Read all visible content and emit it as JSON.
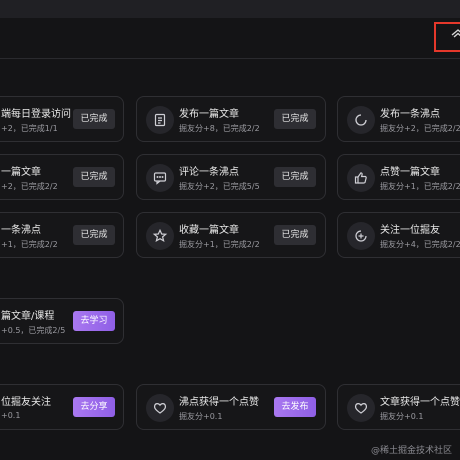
{
  "accent_color": "#9b6bf0",
  "header": {
    "settings_icon": "gear-icon"
  },
  "rows": [
    {
      "cards": [
        {
          "icon": "user-icon",
          "title": "端每日登录访问",
          "sub": "+2，已完成1/1",
          "btn": "已完成",
          "btn_type": "done"
        },
        {
          "icon": "document-icon",
          "title": "发布一篇文章",
          "sub": "掘友分+8，已完成2/2",
          "btn": "已完成",
          "btn_type": "done"
        },
        {
          "icon": "spinner-icon",
          "title": "发布一条沸点",
          "sub": "掘友分+2，已完成2/2",
          "btn": "",
          "btn_type": "none"
        }
      ]
    },
    {
      "cards": [
        {
          "icon": "document-icon",
          "title": "一篇文章",
          "sub": "+2，已完成2/2",
          "btn": "已完成",
          "btn_type": "done"
        },
        {
          "icon": "comment-icon",
          "title": "评论一条沸点",
          "sub": "掘友分+2，已完成5/5",
          "btn": "已完成",
          "btn_type": "done"
        },
        {
          "icon": "thumbs-up-icon",
          "title": "点赞一篇文章",
          "sub": "掘友分+1，已完成2/2",
          "btn": "",
          "btn_type": "none"
        }
      ]
    },
    {
      "cards": [
        {
          "icon": "star-icon",
          "title": "一条沸点",
          "sub": "+1，已完成2/2",
          "btn": "已完成",
          "btn_type": "done"
        },
        {
          "icon": "star-icon",
          "title": "收藏一篇文章",
          "sub": "掘友分+1，已完成2/2",
          "btn": "已完成",
          "btn_type": "done"
        },
        {
          "icon": "follow-icon",
          "title": "关注一位掘友",
          "sub": "掘友分+4，已完成2/2",
          "btn": "",
          "btn_type": "none"
        }
      ]
    },
    {
      "cards": [
        {
          "icon": "book-icon",
          "title": "篇文章/课程",
          "sub": "+0.5，已完成2/5",
          "btn": "去学习",
          "btn_type": "go"
        }
      ]
    },
    {
      "cards": [
        {
          "icon": "share-icon",
          "title": "位掘友关注",
          "sub": "+0.1",
          "btn": "去分享",
          "btn_type": "go"
        },
        {
          "icon": "heart-icon",
          "title": "沸点获得一个点赞",
          "sub": "掘友分+0.1",
          "btn": "去发布",
          "btn_type": "go"
        },
        {
          "icon": "heart-icon",
          "title": "文章获得一个点赞",
          "sub": "掘友分+0.1",
          "btn": "",
          "btn_type": "none"
        }
      ]
    }
  ],
  "watermark": "@稀土掘金技术社区"
}
